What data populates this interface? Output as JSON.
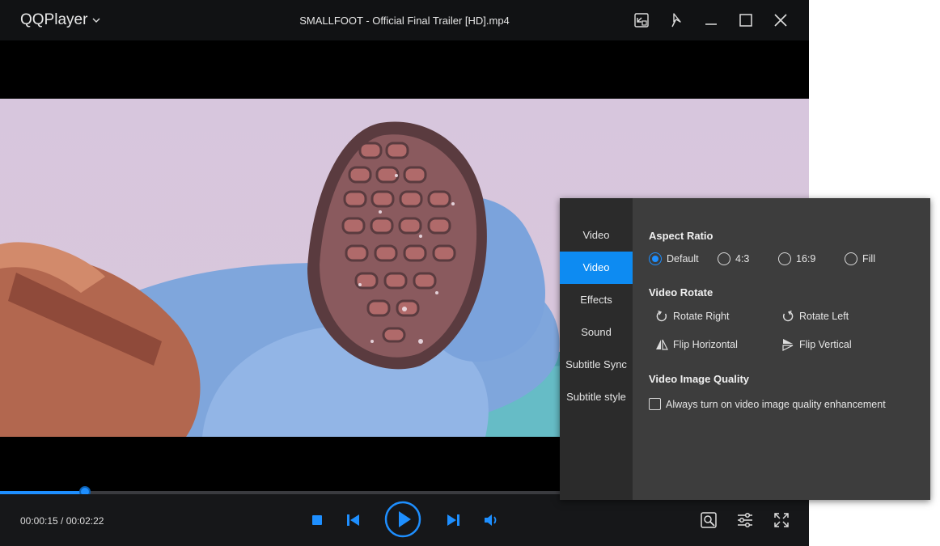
{
  "app": {
    "name": "QQPlayer",
    "file_title": "SMALLFOOT - Official Final Trailer [HD].mp4"
  },
  "titlebar": {
    "buttons": [
      "mini-mode-icon",
      "pin-icon",
      "minimize-icon",
      "maximize-icon",
      "close-icon"
    ]
  },
  "playback": {
    "current_time": "00:00:15",
    "total_time": "00:02:22",
    "time_label": "00:00:15 / 00:02:22",
    "progress": 0.105
  },
  "controls": {
    "icons": [
      "stop-icon",
      "previous-icon",
      "play-icon",
      "next-icon",
      "volume-icon",
      "screenshot-icon",
      "settings-icon",
      "fullscreen-icon"
    ]
  },
  "panel": {
    "nav": [
      {
        "label": "Video",
        "active": false
      },
      {
        "label": "Video",
        "active": true
      },
      {
        "label": "Effects",
        "active": false
      },
      {
        "label": "Sound",
        "active": false
      },
      {
        "label": "Subtitle Sync",
        "active": false
      },
      {
        "label": "Subtitle style",
        "active": false
      }
    ],
    "aspect_ratio": {
      "title": "Aspect Ratio",
      "options": [
        "Default",
        "4:3",
        "16:9",
        "Fill"
      ],
      "selected": "Default"
    },
    "rotate": {
      "title": "Video Rotate",
      "rotate_right": "Rotate Right",
      "rotate_left": "Rotate Left",
      "flip_horizontal": "Flip Horizontal",
      "flip_vertical": "Flip Vertical"
    },
    "quality": {
      "title": "Video Image Quality",
      "checkbox_label": "Always turn on video image quality enhancement",
      "checked": false
    }
  },
  "colors": {
    "accent": "#0d8bf2",
    "panel_bg": "#3d3d3d",
    "nav_bg": "#2b2b2b"
  }
}
